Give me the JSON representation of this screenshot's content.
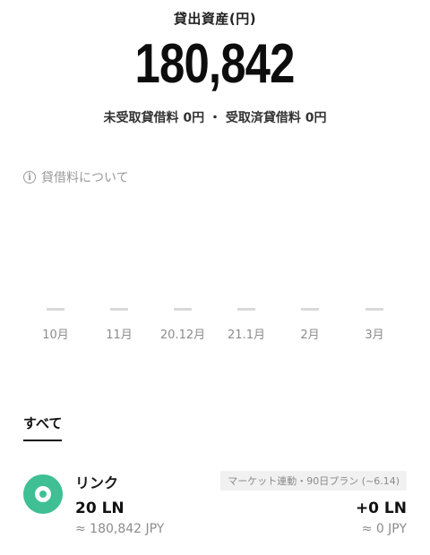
{
  "header": {
    "label": "貸出資産(円)",
    "amount": "180,842",
    "unreceived": "未受取貸借料 0円",
    "separator": "・",
    "received": "受取済貸借料 0円"
  },
  "info_link": {
    "label": "貸借料について"
  },
  "chart": {
    "months": [
      "10月",
      "11月",
      "20.12月",
      "21.1月",
      "2月",
      "3月"
    ]
  },
  "tabs": {
    "all": "すべて"
  },
  "asset": {
    "name": "リンク",
    "amount": "20 LN",
    "jpy": "≈ 180,842 JPY",
    "plan": "マーケット連動・90日プラン (~6.14)",
    "change": "+0 LN",
    "change_jpy": "≈ 0 JPY",
    "icon_color": "#3fbf93"
  }
}
